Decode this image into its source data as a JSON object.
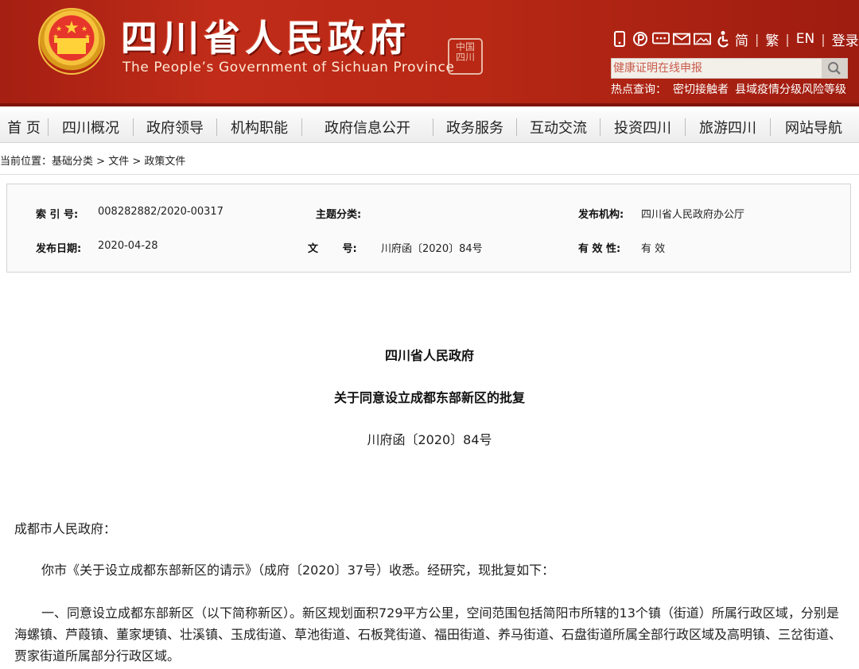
{
  "header": {
    "title_cn": "四川省人民政府",
    "title_en": "The People’s Government of Sichuan Province",
    "seal_text": "中国四川",
    "lang_simplified": "简",
    "lang_traditional": "繁",
    "lang_en": "EN",
    "login": "登录",
    "search_placeholder": "健康证明在线申报",
    "hot_label": "热点查询：",
    "hot_links": [
      "密切接触者",
      "县域疫情分级风险等级"
    ]
  },
  "nav": {
    "items": [
      "首 页",
      "四川概况",
      "政府领导",
      "机构职能",
      "政府信息公开",
      "政务服务",
      "互动交流",
      "投资四川",
      "旅游四川",
      "网站导航"
    ]
  },
  "breadcrumb": {
    "prefix": "当前位置：",
    "items": [
      "基础分类",
      "文件",
      "政策文件"
    ],
    "sep": ">"
  },
  "info": {
    "index_label": "索 引 号:",
    "index_value": "008282882/2020-00317",
    "topic_label": "主题分类:",
    "topic_value": "",
    "org_label": "发布机构:",
    "org_value": "四川省人民政府办公厅",
    "date_label": "发布日期:",
    "date_value": "2020-04-28",
    "docno_label": "文　　 号:",
    "docno_value": "川府函〔2020〕84号",
    "validity_label": "有 效 性:",
    "validity_value": "有 效"
  },
  "article": {
    "issuer": "四川省人民政府",
    "title": "关于同意设立成都东部新区的批复",
    "doc_number": "川府函〔2020〕84号",
    "addressee": "成都市人民政府：",
    "para1": "你市《关于设立成都东部新区的请示》（成府〔2020〕37号）收悉。经研究，现批复如下：",
    "para2": "一、同意设立成都东部新区（以下简称新区）。新区规划面积729平方公里，空间范围包括简阳市所辖的13个镇（街道）所属行政区域，分别是海螺镇、芦葭镇、董家埂镇、壮溪镇、玉成街道、草池街道、石板凳街道、福田街道、养马街道、石盘街道所属全部行政区域及高明镇、三岔街道、贾家街道所属部分行政区域。"
  },
  "colors": {
    "banner": "#b82815",
    "nav_bg": "#efefef"
  }
}
